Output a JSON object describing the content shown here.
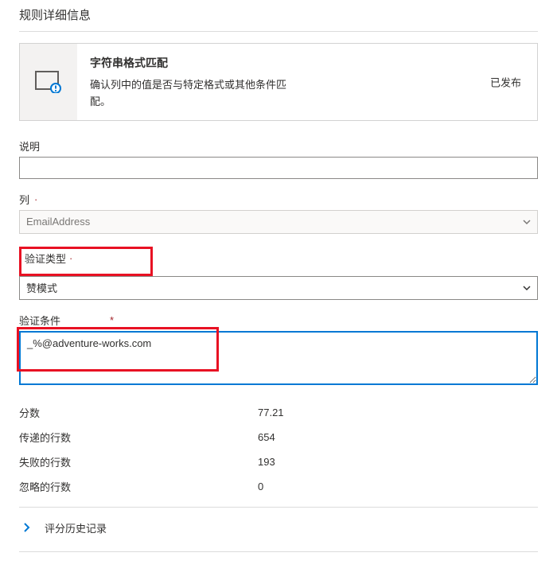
{
  "page": {
    "title": "规则详细信息"
  },
  "card": {
    "title": "字符串格式匹配",
    "desc": "确认列中的值是否与特定格式或其他条件匹配。",
    "status": "已发布"
  },
  "fields": {
    "description": {
      "label": "说明",
      "value": ""
    },
    "column": {
      "label": "列",
      "required": "·",
      "value": "EmailAddress"
    },
    "vtype": {
      "label": "验证类型",
      "required": "·",
      "value": "赞模式"
    },
    "vcond": {
      "label": "验证条件",
      "required": "*",
      "value": "_%@adventure-works.com"
    }
  },
  "stats": {
    "score": {
      "label": "分数",
      "value": "77.21"
    },
    "passed": {
      "label": "传递的行数",
      "value": "654"
    },
    "failed": {
      "label": "失败的行数",
      "value": "193"
    },
    "ignored": {
      "label": "忽略的行数",
      "value": "0"
    }
  },
  "history": {
    "label": "评分历史记录"
  }
}
